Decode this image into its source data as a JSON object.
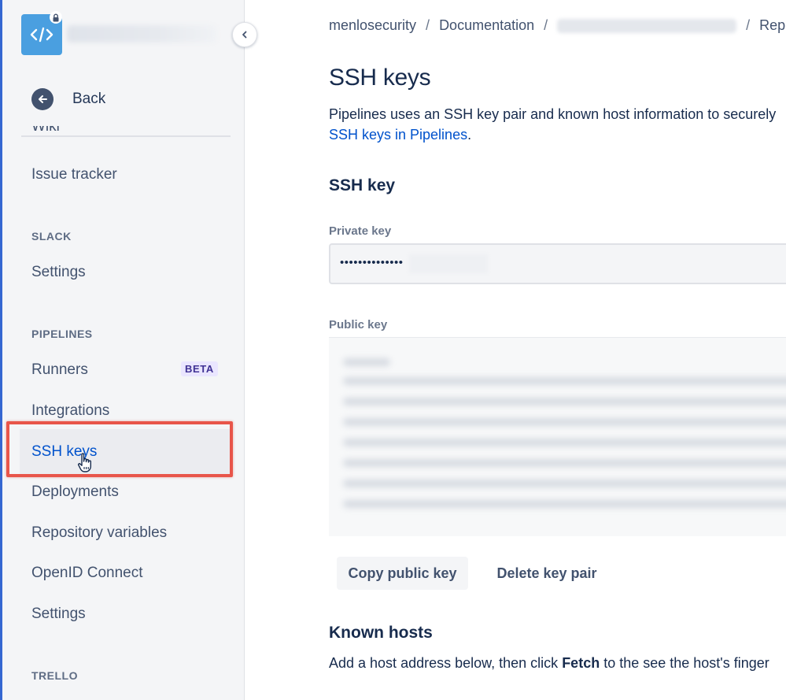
{
  "sidebar": {
    "repo_icon": "code-brackets-icon",
    "lock_icon": "lock-icon",
    "collapse_icon": "chevron-left-icon",
    "back": {
      "icon": "arrow-left-circle-icon",
      "label": "Back"
    },
    "partial_item": "Wiki",
    "items": [
      {
        "label": "Issue tracker"
      },
      {
        "section": "SLACK"
      },
      {
        "label": "Settings"
      },
      {
        "section": "PIPELINES"
      },
      {
        "label": "Runners",
        "badge": "BETA"
      },
      {
        "label": "Integrations"
      },
      {
        "label": "SSH keys",
        "active": true
      },
      {
        "label": "Deployments"
      },
      {
        "label": "Repository variables"
      },
      {
        "label": "OpenID Connect"
      },
      {
        "label": "Settings"
      },
      {
        "section": "TRELLO"
      }
    ]
  },
  "breadcrumb": {
    "items": [
      "menlosecurity",
      "Documentation",
      "Rep"
    ],
    "separator": "/"
  },
  "page": {
    "title": "SSH keys",
    "intro_line1": "Pipelines uses an SSH key pair and known host information to securely",
    "intro_link": "SSH keys in Pipelines",
    "intro_link_suffix": "."
  },
  "ssh_key": {
    "heading": "SSH key",
    "private_label": "Private key",
    "private_value": "••••••••••••••",
    "public_label": "Public key",
    "copy_button": "Copy public key",
    "delete_button": "Delete key pair"
  },
  "known_hosts": {
    "heading": "Known hosts",
    "text_before": "Add a host address below, then click ",
    "text_bold": "Fetch",
    "text_after": " to the see the host's finger"
  },
  "colors": {
    "accent": "#0052cc",
    "highlight": "#e8554a",
    "repo_icon_bg": "#4a9fe0",
    "beta_bg": "#eae6ff",
    "beta_text": "#403294"
  }
}
